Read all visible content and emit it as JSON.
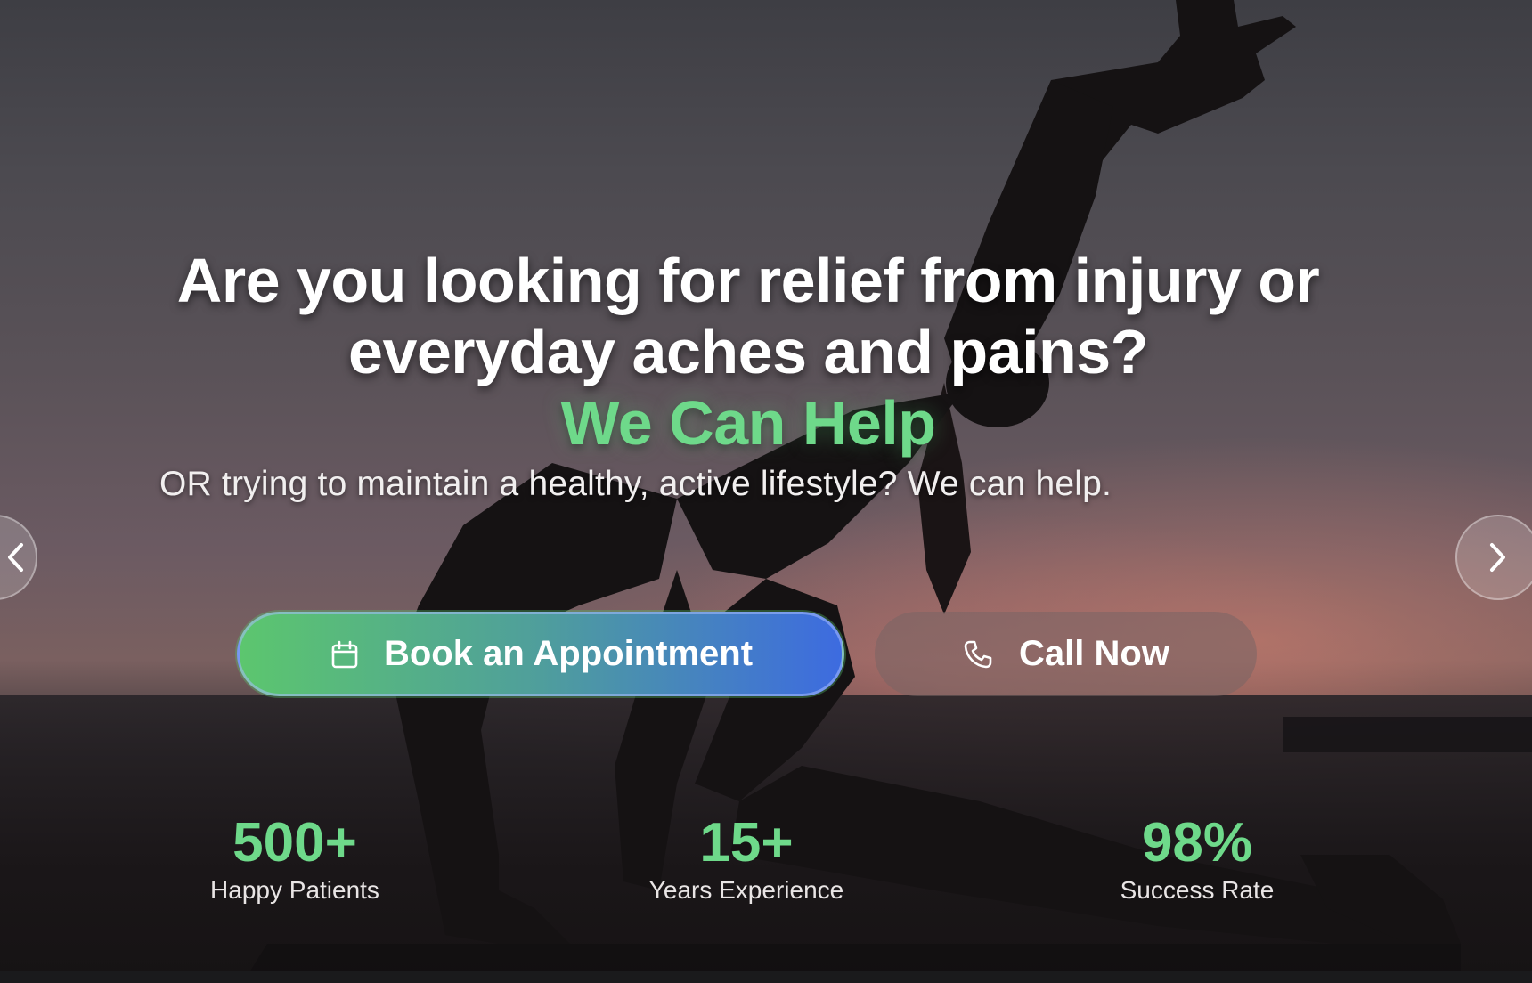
{
  "hero": {
    "headline_line1": "Are you looking for relief from injury or",
    "headline_line2": "everyday aches and pains?",
    "headline_accent": "We Can Help",
    "subtext": "OR trying to maintain a healthy, active lifestyle? We can help."
  },
  "buttons": {
    "book_label": "Book an Appointment",
    "book_icon": "calendar-icon",
    "call_label": "Call Now",
    "call_icon": "phone-icon"
  },
  "carousel": {
    "prev_icon": "chevron-left-icon",
    "next_icon": "chevron-right-icon"
  },
  "stats": [
    {
      "value": "500+",
      "label": "Happy Patients"
    },
    {
      "value": "15+",
      "label": "Years Experience"
    },
    {
      "value": "98%",
      "label": "Success Rate"
    }
  ],
  "colors": {
    "accent_green": "#6ed98a",
    "button_gradient_start": "#5cc66e",
    "button_gradient_end": "#3d6be0"
  }
}
